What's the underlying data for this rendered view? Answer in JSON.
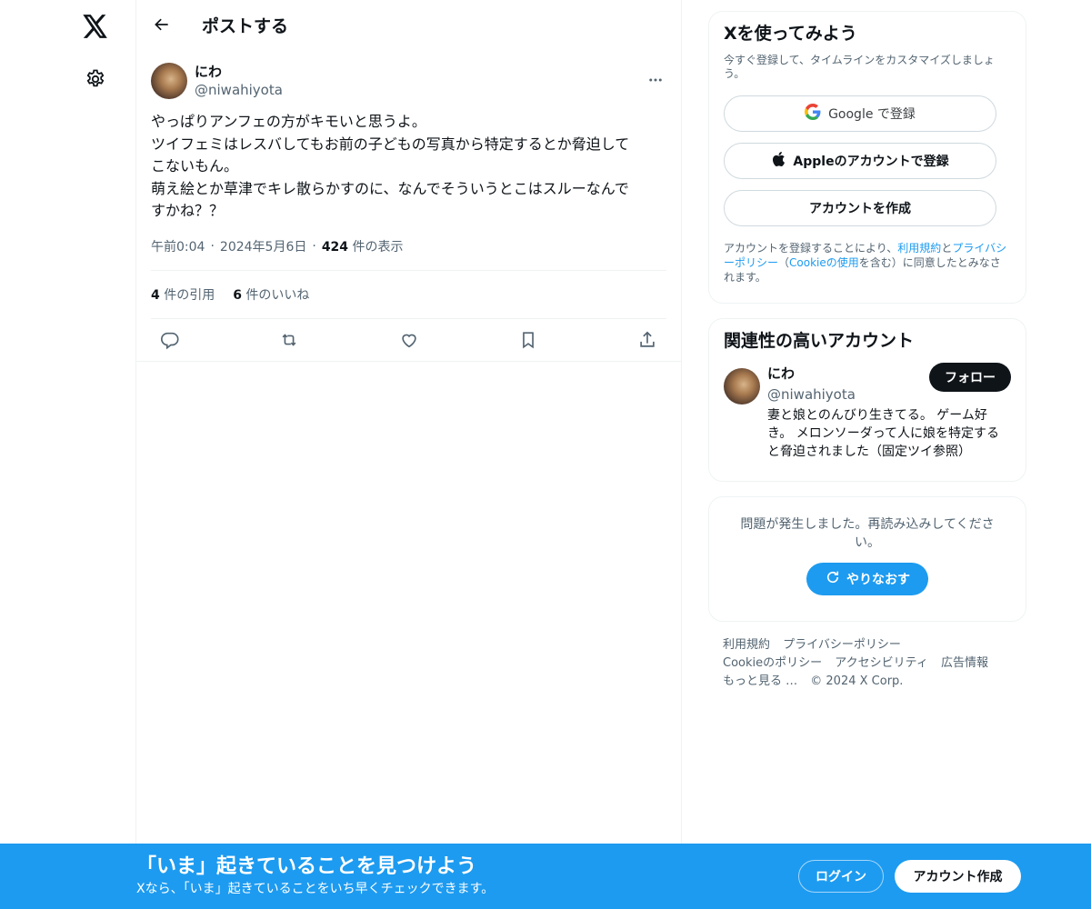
{
  "header": {
    "title": "ポストする"
  },
  "tweet": {
    "author_name": "にわ",
    "author_handle": "@niwahiyota",
    "text": "やっぱりアンフェの方がキモいと思うよ。\nツイフェミはレスバしてもお前の子どもの写真から特定するとか脅迫して\nこないもん。\n萌え絵とか草津でキレ散らかすのに、なんでそういうとこはスルーなんで\nすかね？？",
    "time": "午前0:04",
    "date": "2024年5月6日",
    "views_count": "424",
    "views_label": "件の表示",
    "separator": "·",
    "quotes_count": "4",
    "quotes_label": "件の引用",
    "likes_count": "6",
    "likes_label": "件のいいね"
  },
  "signup": {
    "title": "Xを使ってみよう",
    "subtitle": "今すぐ登録して、タイムラインをカスタマイズしましょう。",
    "google_label": "Google で登録",
    "apple_label": "Appleのアカウントで登録",
    "create_label": "アカウントを作成",
    "terms_prefix": "アカウントを登録することにより、",
    "terms_link": "利用規約",
    "terms_and": "と",
    "privacy_link": "プライバシーポリシー",
    "terms_open": "（",
    "cookie_link": "Cookieの使用",
    "terms_suffix": "を含む）に同意したとみなされます。"
  },
  "related": {
    "title": "関連性の高いアカウント",
    "name": "にわ",
    "handle": "@niwahiyota",
    "bio": "妻と娘とのんびり生きてる。 ゲーム好き。 メロンソーダって人に娘を特定すると脅迫されました（固定ツイ参照）",
    "follow_label": "フォロー"
  },
  "error": {
    "message": "問題が発生しました。再読み込みしてください。",
    "retry_label": "やりなおす"
  },
  "footer": {
    "terms": "利用規約",
    "privacy": "プライバシーポリシー",
    "cookie": "Cookieのポリシー",
    "accessibility": "アクセシビリティ",
    "ads": "広告情報",
    "more": "もっと見る …",
    "copyright": "© 2024 X Corp."
  },
  "banner": {
    "title": "「いま」起きていることを見つけよう",
    "subtitle": "Xなら、「いま」起きていることをいち早くチェックできます。",
    "login_label": "ログイン",
    "create_label": "アカウント作成"
  },
  "colors": {
    "accent": "#1d9bf0",
    "text": "#0f1419",
    "muted": "#536471",
    "border": "#eff3f4"
  },
  "icons": [
    "x-logo-icon",
    "gear-icon",
    "back-arrow-icon",
    "more-dots-icon",
    "reply-icon",
    "repost-icon",
    "like-icon",
    "bookmark-icon",
    "share-icon",
    "google-icon",
    "apple-icon",
    "refresh-icon"
  ]
}
